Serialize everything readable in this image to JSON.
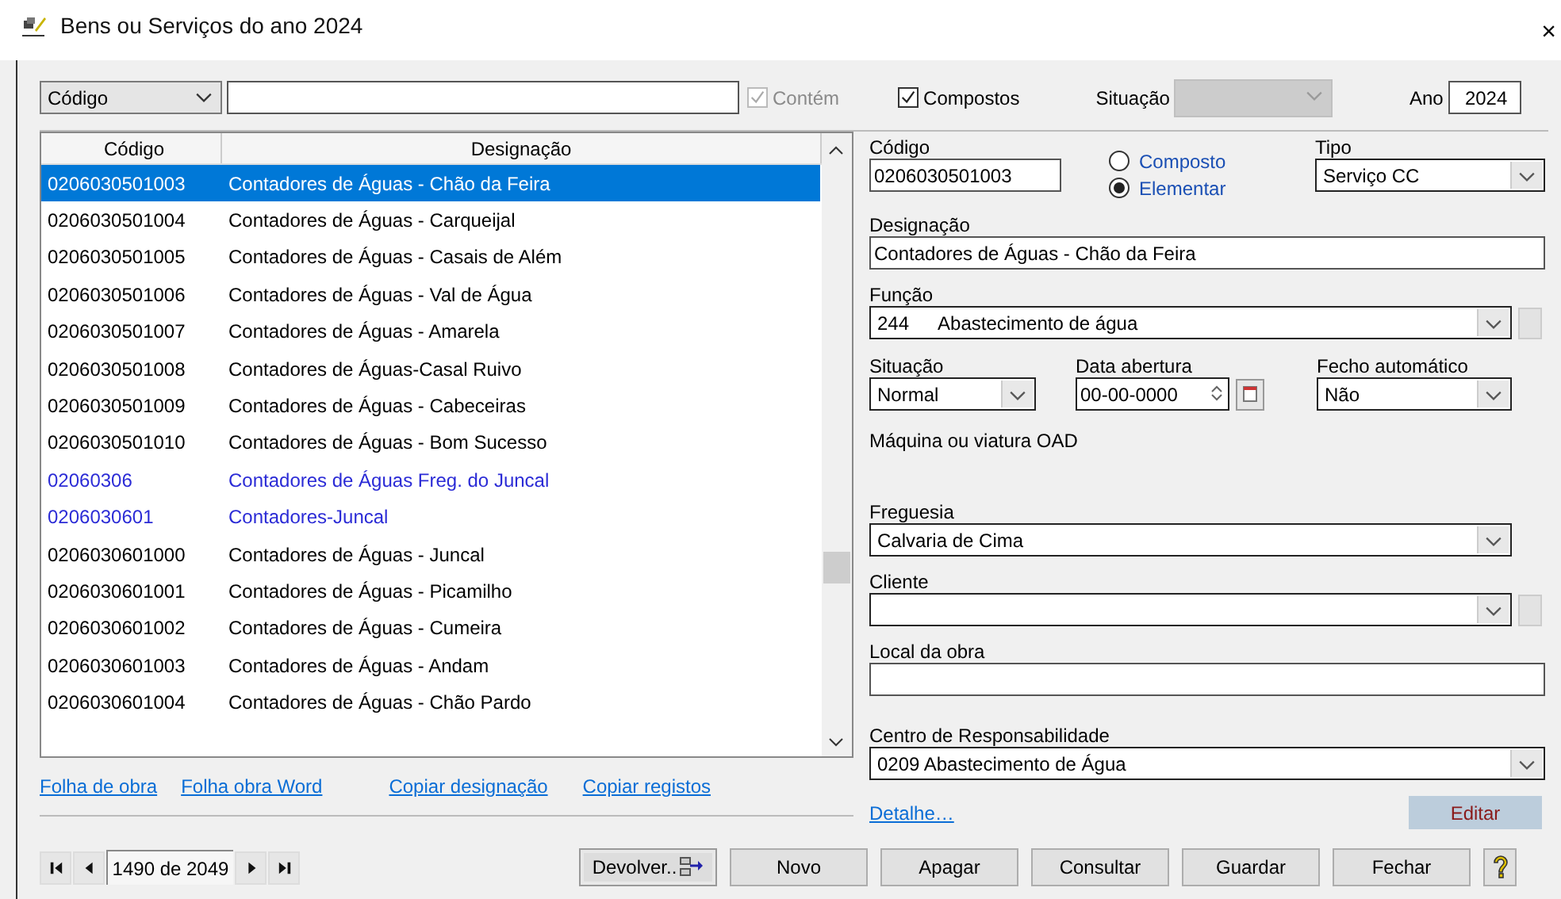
{
  "window": {
    "title": "Bens ou Serviços do ano 2024",
    "close": "×"
  },
  "filter": {
    "field": "Código",
    "contains": {
      "label": "Contém",
      "checked": true,
      "disabled": true
    },
    "composites": {
      "label": "Compostos",
      "checked": true
    },
    "situation": {
      "label": "Situação",
      "disabled": true
    },
    "year": {
      "label": "Ano",
      "value": "2024"
    }
  },
  "table": {
    "columns": [
      "Código",
      "Designação"
    ],
    "rows": [
      {
        "code": "0206030501003",
        "name": "Contadores de Águas - Chão da Feira",
        "composite": false,
        "selected": true
      },
      {
        "code": "0206030501004",
        "name": "Contadores de Águas - Carqueijal",
        "composite": false,
        "selected": false
      },
      {
        "code": "0206030501005",
        "name": "Contadores de Águas - Casais de Além",
        "composite": false,
        "selected": false
      },
      {
        "code": "0206030501006",
        "name": "Contadores de Águas - Val de Água",
        "composite": false,
        "selected": false
      },
      {
        "code": "0206030501007",
        "name": "Contadores de Águas - Amarela",
        "composite": false,
        "selected": false
      },
      {
        "code": "0206030501008",
        "name": "Contadores de Águas-Casal Ruivo",
        "composite": false,
        "selected": false
      },
      {
        "code": "0206030501009",
        "name": "Contadores de Águas - Cabeceiras",
        "composite": false,
        "selected": false
      },
      {
        "code": "0206030501010",
        "name": "Contadores de Águas - Bom Sucesso",
        "composite": false,
        "selected": false
      },
      {
        "code": "02060306",
        "name": "Contadores de Águas Freg. do Juncal",
        "composite": true,
        "selected": false
      },
      {
        "code": "0206030601",
        "name": "Contadores-Juncal",
        "composite": true,
        "selected": false
      },
      {
        "code": "0206030601000",
        "name": "Contadores de Águas - Juncal",
        "composite": false,
        "selected": false
      },
      {
        "code": "0206030601001",
        "name": "Contadores de Águas - Picamilho",
        "composite": false,
        "selected": false
      },
      {
        "code": "0206030601002",
        "name": "Contadores de Águas - Cumeira",
        "composite": false,
        "selected": false
      },
      {
        "code": "0206030601003",
        "name": "Contadores de Águas - Andam",
        "composite": false,
        "selected": false
      },
      {
        "code": "0206030601004",
        "name": "Contadores de Águas - Chão Pardo",
        "composite": false,
        "selected": false
      }
    ]
  },
  "links": [
    "Folha de obra",
    "Folha obra Word",
    "Copiar designação",
    "Copiar registos"
  ],
  "detail": {
    "code": {
      "label": "Código",
      "value": "0206030501003"
    },
    "nature": [
      {
        "label": "Composto",
        "selected": false
      },
      {
        "label": "Elementar",
        "selected": true
      }
    ],
    "type": {
      "label": "Tipo",
      "value": "Serviço CC"
    },
    "designation": {
      "label": "Designação",
      "value": "Contadores de Águas - Chão da Feira"
    },
    "function": {
      "label": "Função",
      "code": "244",
      "value": "Abastecimento de água"
    },
    "situation": {
      "label": "Situação",
      "value": "Normal"
    },
    "opening_date": {
      "label": "Data abertura",
      "value": "00-00-0000"
    },
    "auto_close": {
      "label": "Fecho automático",
      "value": "Não"
    },
    "machine": "Máquina ou viatura OAD",
    "parish": {
      "label": "Freguesia",
      "value": "Calvaria de Cima"
    },
    "client": {
      "label": "Cliente"
    },
    "site": {
      "label": "Local da obra"
    },
    "responsibility": {
      "label": "Centro de Responsabilidade",
      "value": "0209  Abastecimento de Água"
    },
    "detail_link": "Detalhe…",
    "edit_button": "Editar"
  },
  "navigator": {
    "position": "1490 de 2049"
  },
  "buttons": [
    {
      "label": "Devolver..",
      "kind": "icon"
    },
    {
      "label": "Novo",
      "kind": "plain"
    },
    {
      "label": "Apagar",
      "kind": "plain"
    },
    {
      "label": "Consultar",
      "kind": "plain"
    },
    {
      "label": "Guardar",
      "kind": "plain"
    },
    {
      "label": "Fechar",
      "kind": "plain"
    }
  ]
}
